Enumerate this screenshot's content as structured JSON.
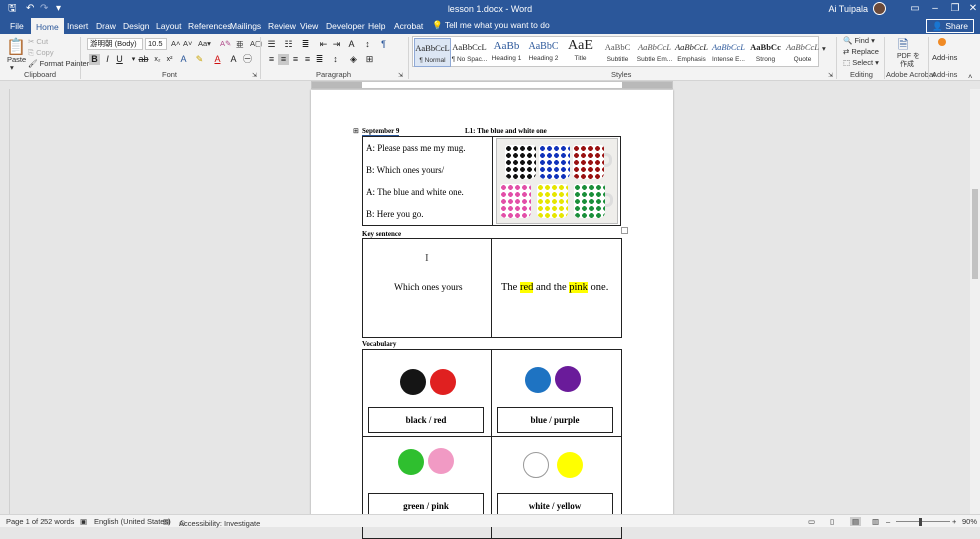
{
  "titlebar": {
    "doc_title": "lesson 1.docx - Word",
    "user_name": "Ai Tuipala"
  },
  "tabs": [
    {
      "label": "File"
    },
    {
      "label": "Home"
    },
    {
      "label": "Insert"
    },
    {
      "label": "Draw"
    },
    {
      "label": "Design"
    },
    {
      "label": "Layout"
    },
    {
      "label": "References"
    },
    {
      "label": "Mailings"
    },
    {
      "label": "Review"
    },
    {
      "label": "View"
    },
    {
      "label": "Developer"
    },
    {
      "label": "Help"
    },
    {
      "label": "Acrobat"
    }
  ],
  "tellme": "Tell me what you want to do",
  "share": "Share",
  "clipboard": {
    "paste": "Paste",
    "cut": "Cut",
    "copy": "Copy",
    "format_painter": "Format Painter",
    "label": "Clipboard"
  },
  "font": {
    "name": "游明朝 (Body)",
    "size": "10.5",
    "label": "Font"
  },
  "paragraph": {
    "label": "Paragraph"
  },
  "styles": {
    "label": "Styles",
    "items": [
      {
        "preview": "AaBbCcL",
        "name": "¶ Normal"
      },
      {
        "preview": "AaBbCcL",
        "name": "¶ No Spac..."
      },
      {
        "preview": "AaBb",
        "name": "Heading 1"
      },
      {
        "preview": "AaBbC",
        "name": "Heading 2"
      },
      {
        "preview": "AaE",
        "name": "Title"
      },
      {
        "preview": "AaBbC",
        "name": "Subtitle"
      },
      {
        "preview": "AaBbCcL",
        "name": "Subtle Em..."
      },
      {
        "preview": "AaBbCcL",
        "name": "Emphasis"
      },
      {
        "preview": "AaBbCcL",
        "name": "Intense E..."
      },
      {
        "preview": "AaBbCc",
        "name": "Strong"
      },
      {
        "preview": "AaBbCcL",
        "name": "Quote"
      }
    ]
  },
  "editing": {
    "find": "Find",
    "replace": "Replace",
    "select": "Select",
    "label": "Editing"
  },
  "acrobat": {
    "pdf": "PDF を",
    "pdf2": "作成",
    "label": "Adobe Acrobat"
  },
  "addins": {
    "btn": "Add-ins",
    "label": "Add-ins"
  },
  "document": {
    "date": "September 9",
    "lesson": "L1: The blue and white one",
    "dialogue": [
      "A: Please pass me my mug.",
      "B: Which ones yours/",
      "A: The blue and white one.",
      "B: Here you go."
    ],
    "key_heading": "Key sentence",
    "key_left": "Which ones yours",
    "key_right": {
      "pre": "The ",
      "w1": "red",
      "mid": " and the ",
      "w2": "pink",
      "post": " one."
    },
    "vocab_heading": "Vocabulary",
    "vocab": [
      {
        "label": "black / red",
        "colors": [
          "#151515",
          "#e02020"
        ]
      },
      {
        "label": "blue / purple",
        "colors": [
          "#1e73c2",
          "#6a1b9a"
        ]
      },
      {
        "label": "green / pink",
        "colors": [
          "#2fbf2f",
          "#f19ac4"
        ]
      },
      {
        "label": "white / yellow",
        "colors": [
          "#ffffff",
          "#ffff00"
        ]
      }
    ],
    "mug_colors": [
      "#111111",
      "#1133bb",
      "#991111",
      "#e24fa8",
      "#e6e600",
      "#1a8f3a"
    ]
  },
  "status": {
    "page": "Page 1 of 2",
    "words": "52 words",
    "language": "English (United States)",
    "accessibility": "Accessibility: Investigate",
    "zoom": "90%"
  }
}
